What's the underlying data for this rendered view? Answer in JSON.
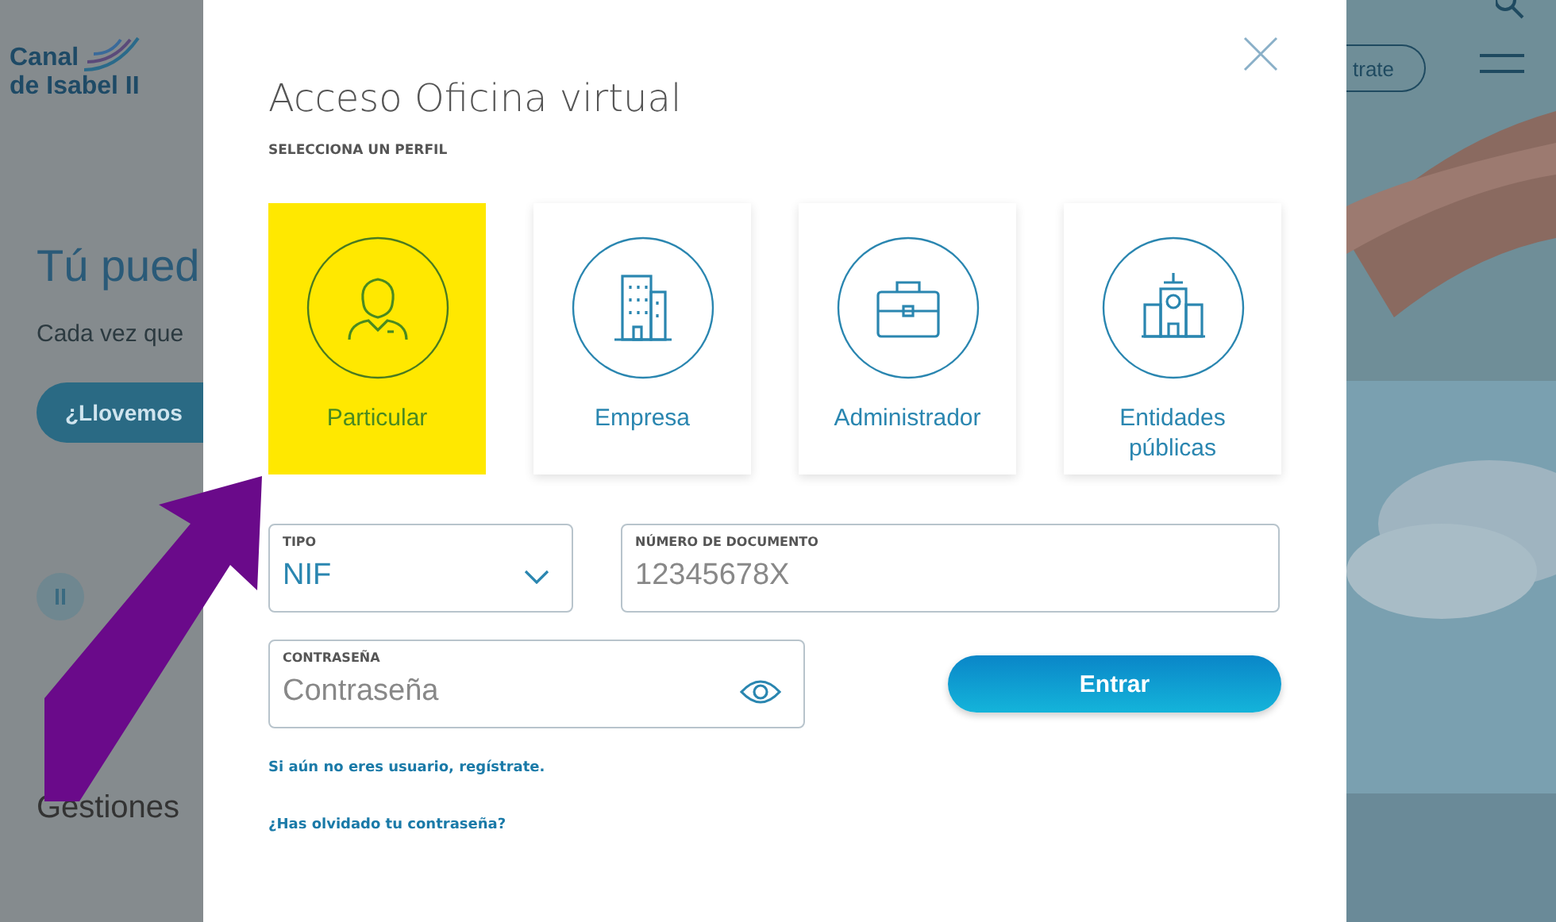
{
  "background": {
    "logo": {
      "line_1": "Canal",
      "line_2": "de Isabel II"
    },
    "headline": "Tú pued",
    "intro": "Cada vez que",
    "cta_button": "¿Llovemos",
    "register_button": "trate",
    "section_title": "Gestiones"
  },
  "modal": {
    "title": "Acceso Oficina virtual",
    "subtitle": "SELECCIONA UN PERFIL",
    "profiles": [
      {
        "label": "Particular",
        "kind": "person",
        "selected": true
      },
      {
        "label": "Empresa",
        "kind": "office",
        "selected": false
      },
      {
        "label": "Administrador",
        "kind": "briefcase",
        "selected": false
      },
      {
        "label": "Entidades públicas",
        "kind": "townhall",
        "selected": false
      }
    ],
    "document_type": {
      "label": "TIPO",
      "value": "NIF"
    },
    "document_number": {
      "label": "NÚMERO DE DOCUMENTO",
      "placeholder": "12345678X"
    },
    "password": {
      "label": "CONTRASEÑA",
      "placeholder": "Contraseña"
    },
    "submit_button": "Entrar",
    "links": [
      "Si aún no eres usuario, regístrate.",
      "¿Has olvidado tu contraseña?"
    ]
  }
}
